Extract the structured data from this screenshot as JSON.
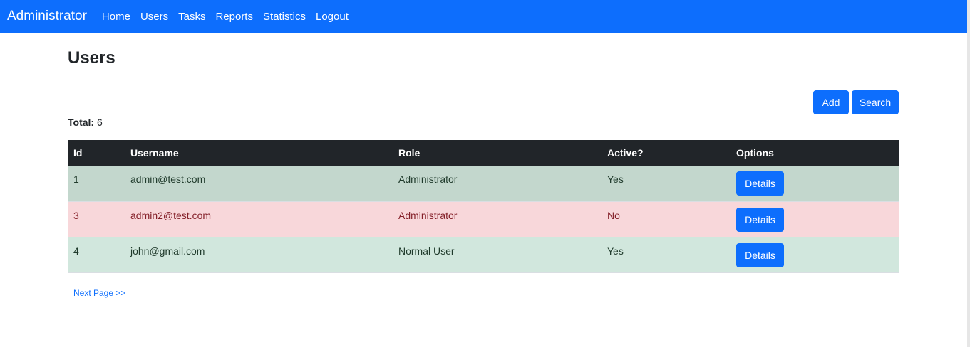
{
  "navbar": {
    "brand": "Administrator",
    "links": [
      "Home",
      "Users",
      "Tasks",
      "Reports",
      "Statistics",
      "Logout"
    ]
  },
  "page": {
    "title": "Users",
    "add_label": "Add",
    "search_label": "Search",
    "total_label": "Total:",
    "total_value": "6"
  },
  "table": {
    "headers": [
      "Id",
      "Username",
      "Role",
      "Active?",
      "Options"
    ],
    "rows": [
      {
        "id": "1",
        "username": "admin@test.com",
        "role": "Administrator",
        "active": "Yes",
        "option": "Details"
      },
      {
        "id": "3",
        "username": "admin2@test.com",
        "role": "Administrator",
        "active": "No",
        "option": "Details"
      },
      {
        "id": "4",
        "username": "john@gmail.com",
        "role": "Normal User",
        "active": "Yes",
        "option": "Details"
      }
    ]
  },
  "pagination": {
    "next_label": "Next Page >>"
  },
  "colors": {
    "primary": "#0d6efd",
    "table_header": "#212529",
    "row_active_dark": "#c3d7cd",
    "row_inactive": "#f8d7da",
    "row_active": "#d1e7dd"
  }
}
